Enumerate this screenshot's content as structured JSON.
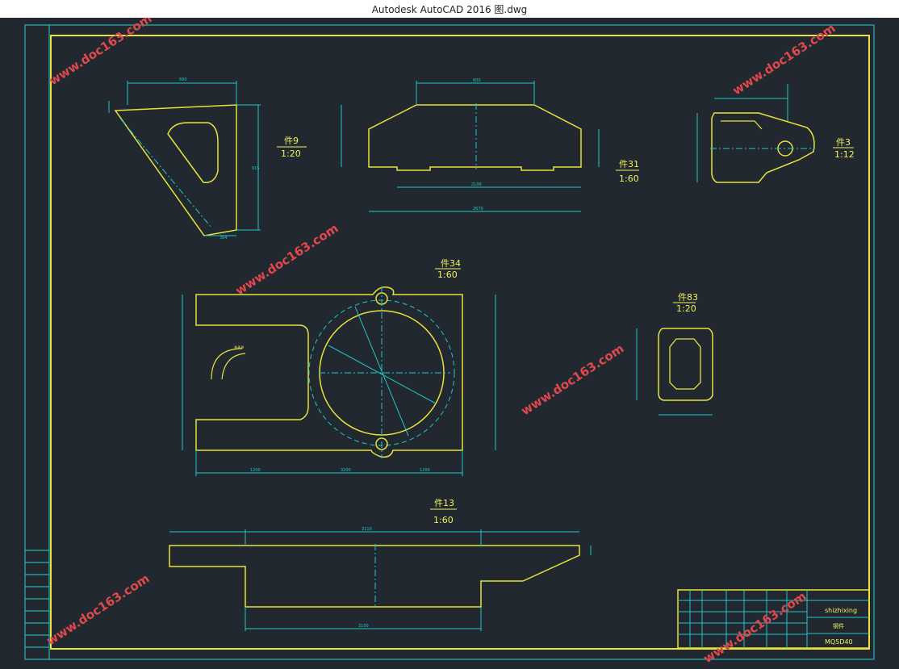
{
  "window": {
    "title": "Autodesk AutoCAD 2016     图.dwg"
  },
  "colors": {
    "background": "#212830",
    "frame": "#e8e23a",
    "dimension": "#20c8c8",
    "watermark": "#e0484c",
    "border": "#2ad1d1",
    "text": "#f2f25a"
  },
  "views": {
    "v9": {
      "label": "件9",
      "scale": "1:20"
    },
    "v31": {
      "label": "件31",
      "scale": "1:60"
    },
    "v3": {
      "label": "件3",
      "scale": "1:12"
    },
    "v34": {
      "label": "件34",
      "scale": "1:60"
    },
    "v83": {
      "label": "件83",
      "scale": "1:20"
    },
    "v13": {
      "label": "件13",
      "scale": "1:60"
    }
  },
  "watermark": {
    "text": "www.doc163.com"
  },
  "title_block": {
    "name": "shizhixing",
    "material": "钢件",
    "drawing_no": "MQ5D40"
  }
}
